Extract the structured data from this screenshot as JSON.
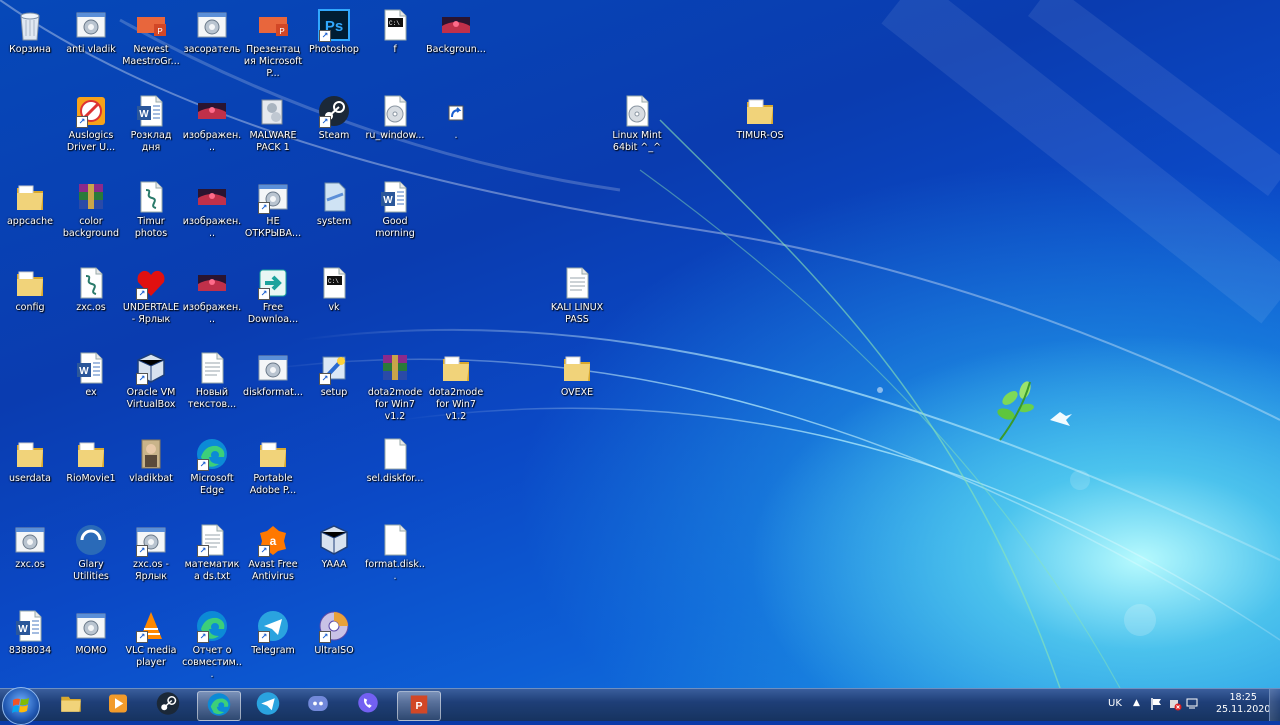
{
  "desktop": {
    "icons": [
      {
        "label": "Корзина",
        "icon": "recycle-bin-icon"
      },
      {
        "label": "anti vladik",
        "icon": "gear-file-icon"
      },
      {
        "label": "Newest MaestroGr...",
        "icon": "powerpoint-file-icon"
      },
      {
        "label": "засоратель",
        "icon": "gear-file-icon"
      },
      {
        "label": "Презентация Microsoft P...",
        "icon": "powerpoint-file-icon"
      },
      {
        "label": "Photoshop",
        "icon": "photoshop-icon"
      },
      {
        "label": "f",
        "icon": "cmd-file-icon"
      },
      {
        "label": "Backgroun...",
        "icon": "image-file-icon"
      },
      {
        "label": "Auslogics Driver U...",
        "icon": "auslogics-icon"
      },
      {
        "label": "Розклад дня",
        "icon": "word-file-icon"
      },
      {
        "label": "изображен...",
        "icon": "image-file-icon"
      },
      {
        "label": "MALWARE PACK 1",
        "icon": "gear-stack-icon"
      },
      {
        "label": "Steam",
        "icon": "steam-icon"
      },
      {
        "label": "ru_window...",
        "icon": "disc-image-icon"
      },
      {
        "label": ".",
        "icon": "shortcut-icon"
      },
      {
        "label": "Linux Mint 64bit ^_^",
        "icon": "disc-image-icon"
      },
      {
        "label": "TIMUR-OS",
        "icon": "folder-icon"
      },
      {
        "label": "appcache",
        "icon": "folder-icon"
      },
      {
        "label": "color background",
        "icon": "winrar-icon"
      },
      {
        "label": "Timur photos",
        "icon": "script-file-icon"
      },
      {
        "label": "изображен...",
        "icon": "image-file-icon"
      },
      {
        "label": "НЕ ОТКРЫВА...",
        "icon": "gear-file-icon"
      },
      {
        "label": "system",
        "icon": "generic-file-icon"
      },
      {
        "label": "Good morning",
        "icon": "word-file-icon"
      },
      {
        "label": "config",
        "icon": "folder-icon"
      },
      {
        "label": "zxc.os",
        "icon": "script-file-icon"
      },
      {
        "label": "UNDERTALE - Ярлык",
        "icon": "heart-icon"
      },
      {
        "label": "изображен...",
        "icon": "image-file-icon"
      },
      {
        "label": "Free Downloa...",
        "icon": "free-download-icon"
      },
      {
        "label": "vk",
        "icon": "cmd-file-icon"
      },
      {
        "label": "KALI LINUX PASS",
        "icon": "text-file-icon"
      },
      {
        "label": "ex",
        "icon": "word-file-icon"
      },
      {
        "label": "Oracle VM VirtualBox",
        "icon": "virtualbox-icon"
      },
      {
        "label": "Новый текстов...",
        "icon": "text-file-icon"
      },
      {
        "label": "diskformat...",
        "icon": "gear-file-icon"
      },
      {
        "label": "setup",
        "icon": "setup-icon"
      },
      {
        "label": "dota2mode for Win7 v1.2",
        "icon": "winrar-icon"
      },
      {
        "label": "dota2mode for Win7 v1.2",
        "icon": "folder-icon"
      },
      {
        "label": "OVEXE",
        "icon": "folder-icon"
      },
      {
        "label": "userdata",
        "icon": "folder-icon"
      },
      {
        "label": "RioMovie1",
        "icon": "folder-icon"
      },
      {
        "label": "vladikbat",
        "icon": "photo-icon"
      },
      {
        "label": "Microsoft Edge",
        "icon": "edge-icon"
      },
      {
        "label": "Portable Adobe P...",
        "icon": "folder-icon"
      },
      {
        "label": "sel.diskfor...",
        "icon": "blank-file-icon"
      },
      {
        "label": "zxc.os",
        "icon": "gear-file-icon"
      },
      {
        "label": "Glary Utilities",
        "icon": "glary-icon"
      },
      {
        "label": "zxc.os - Ярлык",
        "icon": "gear-file-icon"
      },
      {
        "label": "математика ds.txt",
        "icon": "text-file-icon"
      },
      {
        "label": "Avast Free Antivirus",
        "icon": "avast-icon"
      },
      {
        "label": "YAAA",
        "icon": "virtualbox-icon"
      },
      {
        "label": "format.disk...",
        "icon": "blank-file-icon"
      },
      {
        "label": "8388034",
        "icon": "word-file-icon"
      },
      {
        "label": "MOMO",
        "icon": "gear-file-icon"
      },
      {
        "label": "VLC media player",
        "icon": "vlc-icon"
      },
      {
        "label": "Отчет о совместим...",
        "icon": "edge-icon"
      },
      {
        "label": "Telegram",
        "icon": "telegram-icon"
      },
      {
        "label": "UltraISO",
        "icon": "ultraiso-icon"
      }
    ]
  },
  "taskbar": {
    "pinned": [
      {
        "name": "explorer-icon"
      },
      {
        "name": "media-player-icon"
      },
      {
        "name": "steam-icon"
      },
      {
        "name": "edge-icon",
        "active": true
      },
      {
        "name": "telegram-icon"
      },
      {
        "name": "discord-icon"
      },
      {
        "name": "viber-icon"
      },
      {
        "name": "powerpoint-icon",
        "active": true
      }
    ],
    "tray": {
      "language": "UK",
      "time": "18:25",
      "date": "25.11.2020"
    }
  },
  "colors": {
    "accent": "#1f56b0",
    "folder": "#e8c860",
    "label_text": "#ffffff"
  }
}
